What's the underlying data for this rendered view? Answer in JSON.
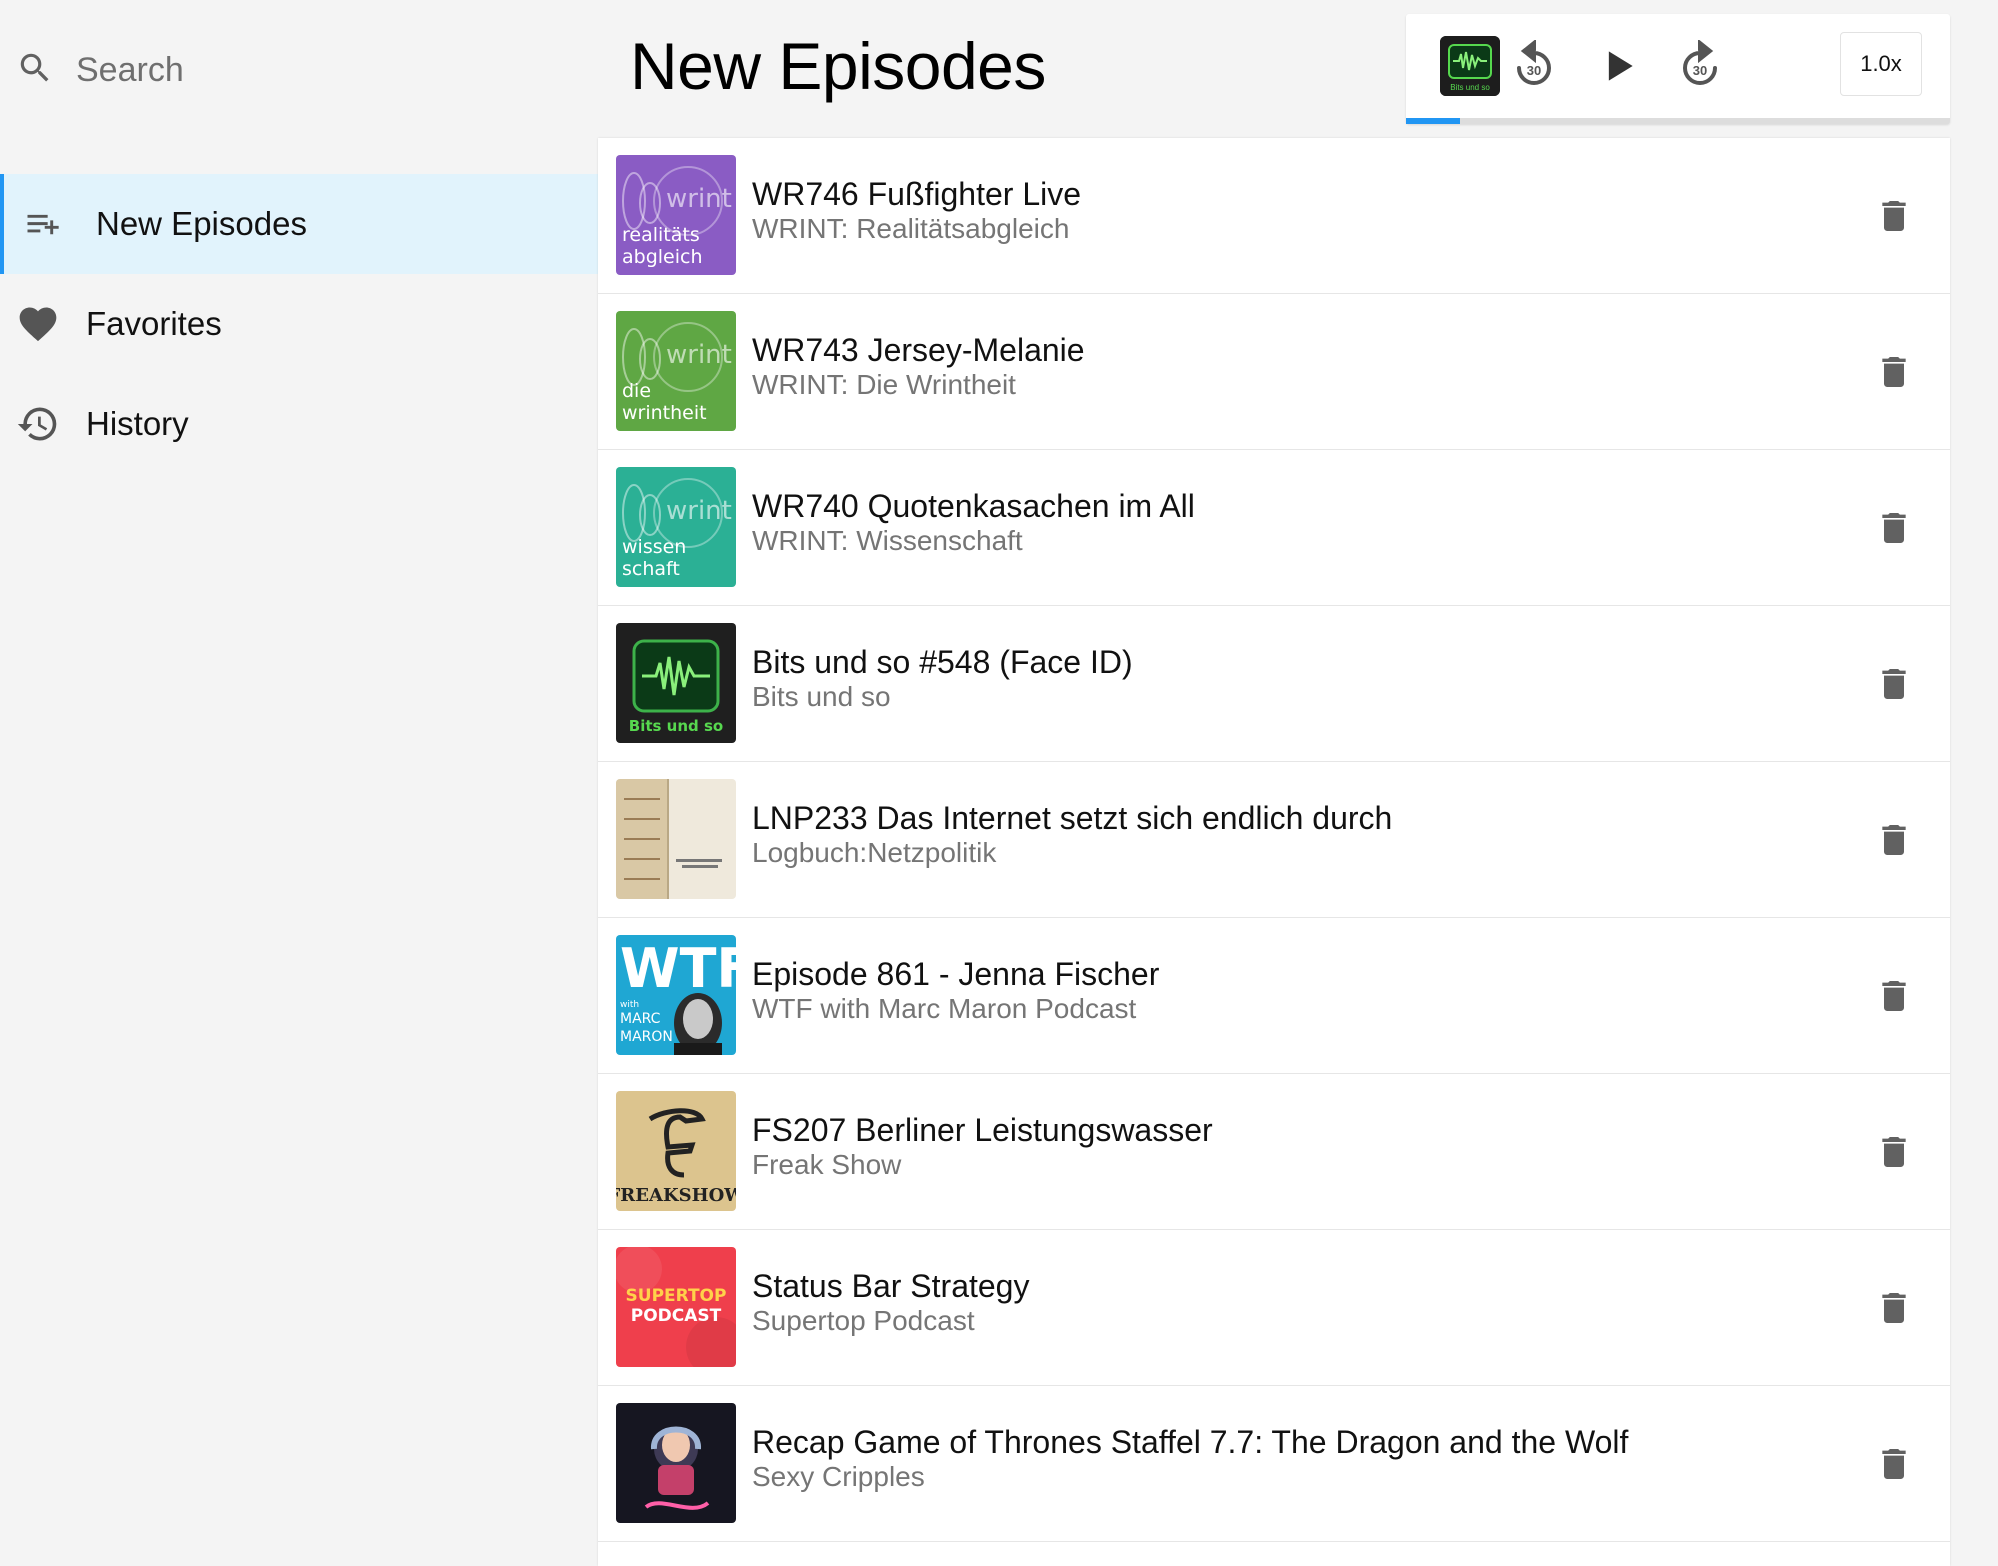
{
  "search": {
    "placeholder": "Search",
    "icon": "search-icon"
  },
  "nav": {
    "items": [
      {
        "label": "New Episodes",
        "icon": "playlist-add-icon",
        "active": true
      },
      {
        "label": "Favorites",
        "icon": "heart-icon",
        "active": false
      },
      {
        "label": "History",
        "icon": "history-icon",
        "active": false
      }
    ]
  },
  "header": {
    "title": "New Episodes"
  },
  "player": {
    "now_playing_art": "Bits und so",
    "skip_back_seconds": "30",
    "skip_forward_seconds": "30",
    "speed": "1.0x",
    "progress_fraction": 0.1,
    "accent_color": "#2196f3"
  },
  "episodes": [
    {
      "title": "WR746 Fußfighter Live",
      "podcast": "WRINT: Realitätsabgleich",
      "art": {
        "style": "wrint",
        "bg": "#8a5cc4",
        "logo": "wrint",
        "lines": [
          "realitäts",
          "abgleich"
        ]
      }
    },
    {
      "title": "WR743 Jersey-Melanie",
      "podcast": "WRINT: Die Wrintheit",
      "art": {
        "style": "wrint",
        "bg": "#5fa744",
        "logo": "wrint",
        "lines": [
          "die",
          "wrintheit"
        ]
      }
    },
    {
      "title": "WR740 Quotenkasachen im All",
      "podcast": "WRINT: Wissenschaft",
      "art": {
        "style": "wrint",
        "bg": "#2bb095",
        "logo": "wrint",
        "lines": [
          "wissen",
          "schaft"
        ]
      }
    },
    {
      "title": "Bits und so #548 (Face ID)",
      "podcast": "Bits und so",
      "art": {
        "style": "bits",
        "bg": "#1f1f1f",
        "lines": [
          "Bits und so"
        ]
      }
    },
    {
      "title": "LNP233 Das Internet setzt sich endlich durch",
      "podcast": "Logbuch:Netzpolitik",
      "art": {
        "style": "paper",
        "bg": "#efe9dc"
      }
    },
    {
      "title": "Episode 861 - Jenna Fischer",
      "podcast": "WTF with Marc Maron Podcast",
      "art": {
        "style": "wtf",
        "bg": "#1fa7d3",
        "logo": "WTF",
        "lines": [
          "with",
          "MARC",
          "MARON"
        ]
      }
    },
    {
      "title": "FS207 Berliner Leistungswasser",
      "podcast": "Freak Show",
      "art": {
        "style": "freak",
        "bg": "#dcc48e",
        "logo": "FREAKSHOW"
      }
    },
    {
      "title": "Status Bar Strategy",
      "podcast": "Supertop Podcast",
      "art": {
        "style": "supertop",
        "bg": "#ef3f4c",
        "lines": [
          "SUPERTOP",
          "PODCAST"
        ]
      }
    },
    {
      "title": "Recap Game of Thrones Staffel 7.7: The Dragon and the Wolf",
      "podcast": "Sexy Cripples",
      "art": {
        "style": "sexy",
        "bg": "#161621"
      }
    }
  ]
}
